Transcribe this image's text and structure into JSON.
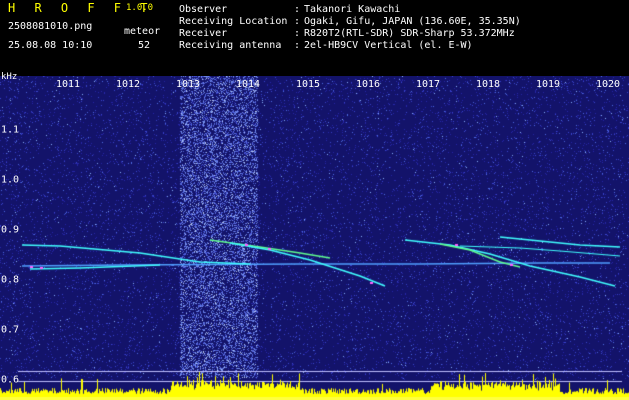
{
  "app": {
    "title": "H R O F F T",
    "version": "1.0.0"
  },
  "file": {
    "name": "2508081010.png",
    "datetime": "25.08.08 10:10"
  },
  "meteor": {
    "label": "meteor",
    "count": "52"
  },
  "info": [
    {
      "key": "Observer",
      "value": "Takanori Kawachi"
    },
    {
      "key": "Receiving Location",
      "value": "Ogaki, Gifu, JAPAN (136.60E, 35.35N)"
    },
    {
      "key": "Receiver",
      "value": "R820T2(RTL-SDR) SDR-Sharp 53.372MHz"
    },
    {
      "key": "Receiving antenna",
      "value": "2el-HB9CV Vertical (el. E-W)"
    }
  ],
  "axis": {
    "y_unit": "kHz",
    "x_ticks": [
      "1011",
      "1012",
      "1013",
      "1014",
      "1015",
      "1016",
      "1017",
      "1018",
      "1019",
      "1020"
    ],
    "y_ticks": [
      "1.1",
      "1.0",
      "0.9",
      "0.8",
      "0.7",
      "0.6"
    ]
  },
  "colors": {
    "header_text": "#ffff00",
    "background": "#1a1a80",
    "echo": "#40ffff",
    "strong": "#ff60ff",
    "baseline": "#ffff00"
  }
}
